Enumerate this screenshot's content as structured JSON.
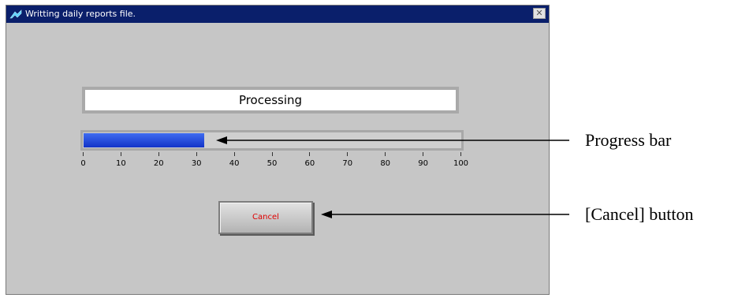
{
  "window": {
    "title": "Writting daily reports file.",
    "close_glyph": "✕",
    "status_text": "Processing",
    "progress_fraction": 0.32,
    "scale_labels": [
      "0",
      "10",
      "20",
      "30",
      "40",
      "50",
      "60",
      "70",
      "80",
      "90",
      "100"
    ],
    "cancel_label": "Cancel"
  },
  "annotations": {
    "progress_bar": "Progress bar",
    "cancel_button": "[Cancel] button"
  },
  "colors": {
    "titlebar": "#0a1f6b",
    "window_bg": "#c6c6c6",
    "progress_fill": "#1233c8",
    "cancel_text": "#e00000"
  },
  "icons": {
    "app": "app-icon",
    "close": "close-icon"
  }
}
